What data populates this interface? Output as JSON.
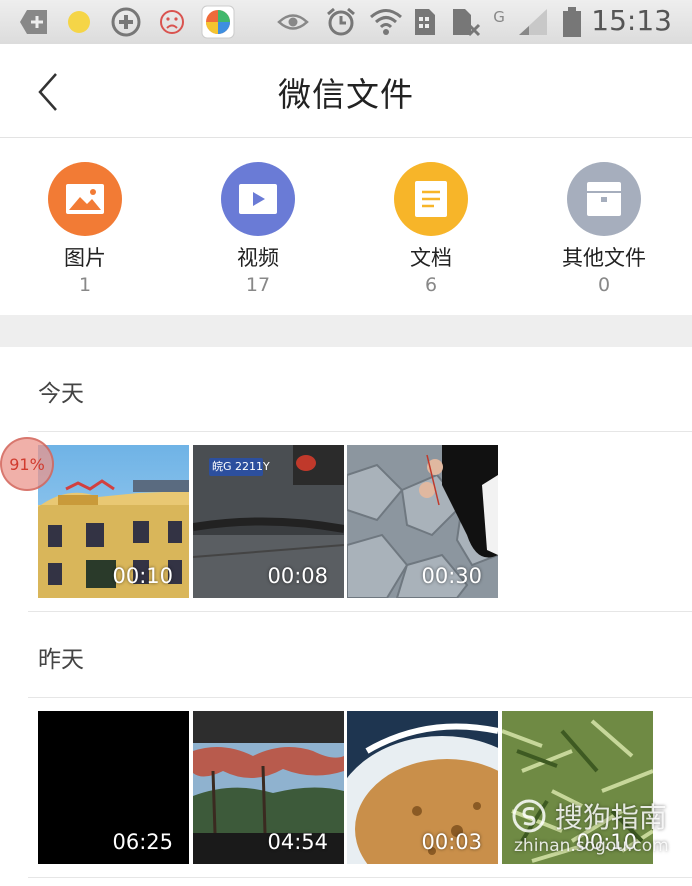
{
  "status_bar": {
    "time": "15:13",
    "network": "G",
    "icons": [
      "add-box-icon",
      "yellow-dot-icon",
      "plus-circle-icon",
      "sad-face-icon",
      "app-store-icon",
      "eye-icon",
      "alarm-icon",
      "wifi-icon",
      "sim-card-icon",
      "no-sim-icon",
      "signal-icon",
      "battery-icon"
    ]
  },
  "header": {
    "title": "微信文件"
  },
  "categories": [
    {
      "label": "图片",
      "count": "1",
      "color": "#F27B35",
      "icon": "image-icon"
    },
    {
      "label": "视频",
      "count": "17",
      "color": "#6A7BD6",
      "icon": "video-icon"
    },
    {
      "label": "文档",
      "count": "6",
      "color": "#F7B529",
      "icon": "document-icon"
    },
    {
      "label": "其他文件",
      "count": "0",
      "color": "#A6AEBD",
      "icon": "other-file-icon"
    }
  ],
  "sections": [
    {
      "title": "今天",
      "videos": [
        {
          "duration": "00:10"
        },
        {
          "duration": "00:08"
        },
        {
          "duration": "00:30"
        }
      ]
    },
    {
      "title": "昨天",
      "videos": [
        {
          "duration": "06:25"
        },
        {
          "duration": "04:54"
        },
        {
          "duration": "00:03"
        },
        {
          "duration": "00:10"
        }
      ]
    }
  ],
  "overlay_badge": "91%",
  "watermark": {
    "brand": "搜狗指南",
    "url": "zhinan.sogou.com"
  },
  "plate_text": "皖G 2211Y"
}
